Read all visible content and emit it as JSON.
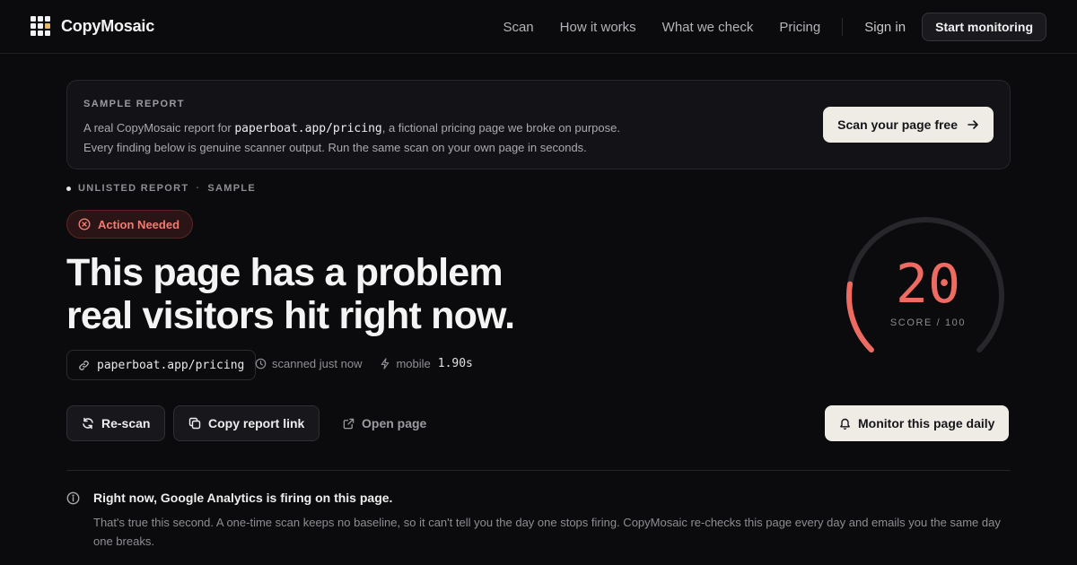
{
  "brand": {
    "name": "CopyMosaic",
    "logo_icon": "grid-logo-icon",
    "accent_color": "#e8b86a"
  },
  "nav": {
    "links": [
      "Scan",
      "How it works",
      "What we check",
      "Pricing"
    ],
    "signin": "Sign in",
    "cta": "Start monitoring"
  },
  "banner": {
    "tag": "SAMPLE REPORT",
    "line1_prefix": "A real CopyMosaic report for ",
    "line1_url": "paperboat.app/pricing",
    "line1_suffix": ", a fictional pricing page we broke on purpose.",
    "line2": "Every finding below is genuine scanner output. Run the same scan on your own page in seconds.",
    "cta": "Scan your page free",
    "cta_icon": "arrow-right-icon"
  },
  "report": {
    "visibility": "UNLISTED REPORT",
    "separator": "·",
    "kind": "SAMPLE",
    "status": {
      "label": "Action Needed",
      "icon": "x-circle-icon",
      "color": "#f07c72"
    },
    "headline_line1": "This page has a problem",
    "headline_line2": "real visitors hit right now.",
    "url": "paperboat.app/pricing",
    "scanned": "scanned just now",
    "device": "mobile",
    "load_time": "1.90s"
  },
  "actions": {
    "rescan": "Re-scan",
    "copy_link": "Copy report link",
    "open_page": "Open page",
    "monitor": "Monitor this page daily"
  },
  "score": {
    "value": "20",
    "max_label": "SCORE / 100",
    "fraction": 0.2,
    "color": "#ee6b62",
    "track_color": "#26262b"
  },
  "notice": {
    "icon": "info-icon",
    "title": "Right now, Google Analytics is firing on this page.",
    "body": "That's true this second. A one-time scan keeps no baseline, so it can't tell you the day one stops firing. CopyMosaic re-checks this page every day and emails you the same day one breaks."
  }
}
